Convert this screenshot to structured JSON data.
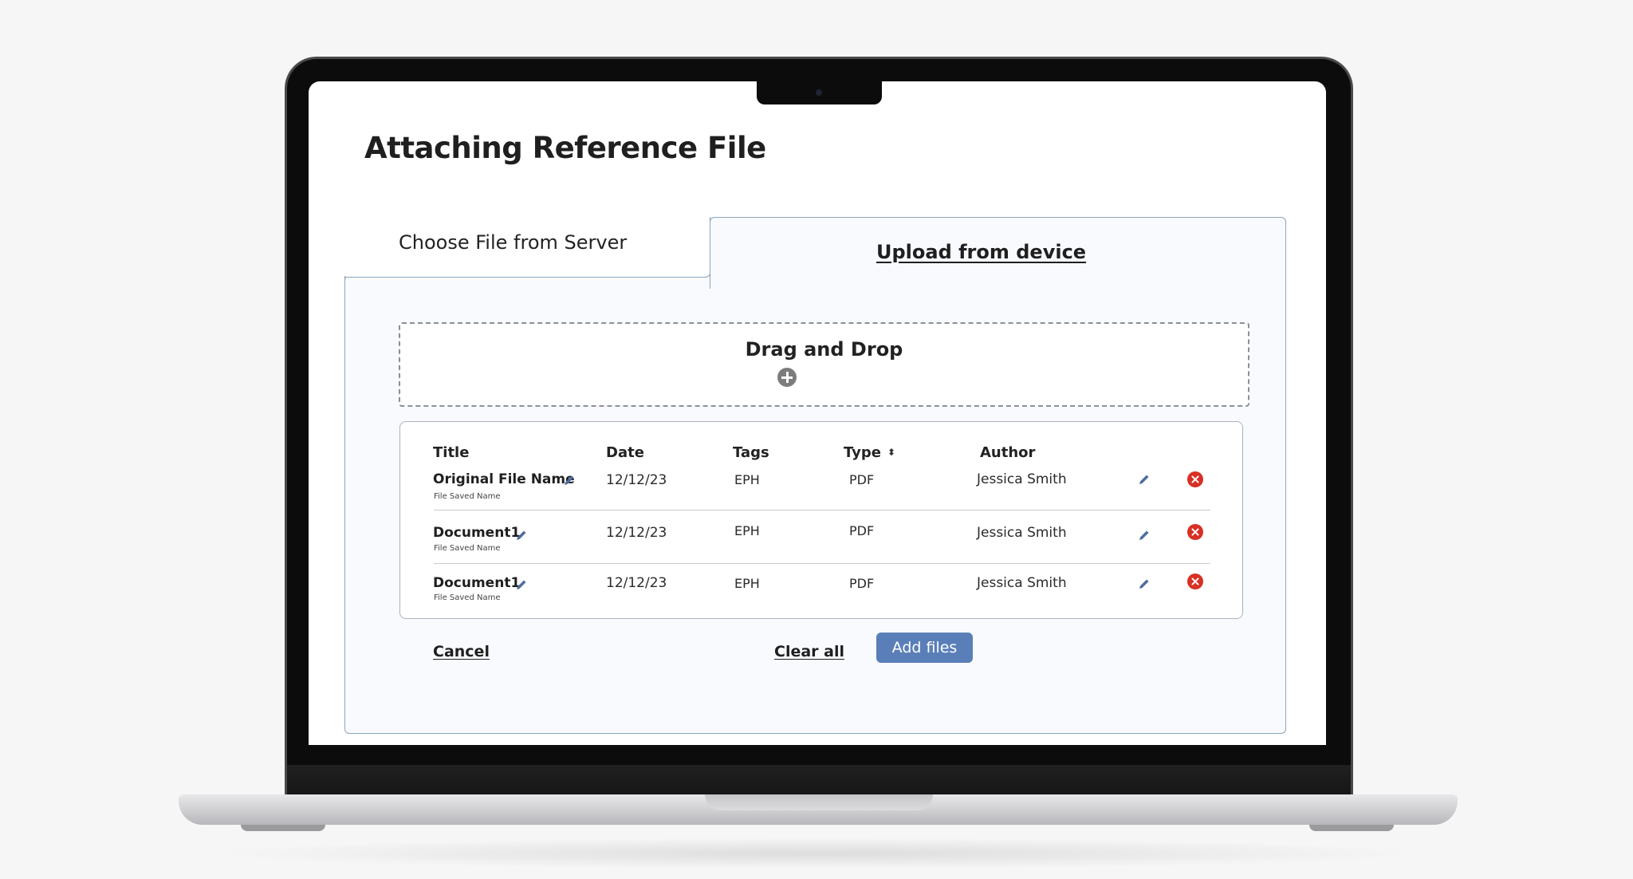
{
  "page": {
    "title": "Attaching Reference File"
  },
  "tabs": [
    {
      "label": "Choose File from Server",
      "active": false
    },
    {
      "label": "Upload from device",
      "active": true
    }
  ],
  "dropzone": {
    "label": "Drag and Drop",
    "icon": "plus-circle-icon"
  },
  "table": {
    "headers": {
      "title": "Title",
      "date": "Date",
      "tags": "Tags",
      "type": "Type",
      "author": "Author"
    },
    "rows": [
      {
        "title": "Original File Name",
        "subtitle": "File Saved Name",
        "date": "12/12/23",
        "tags": "EPH",
        "type": "PDF",
        "author": "Jessica Smith"
      },
      {
        "title": "Document1",
        "subtitle": "File Saved Name",
        "date": "12/12/23",
        "tags": "EPH",
        "type": "PDF",
        "author": "Jessica Smith"
      },
      {
        "title": "Document1",
        "subtitle": "File Saved Name",
        "date": "12/12/23",
        "tags": "EPH",
        "type": "PDF",
        "author": "Jessica Smith"
      }
    ]
  },
  "actions": {
    "cancel": "Cancel",
    "clear_all": "Clear all",
    "add_files": "Add files"
  },
  "colors": {
    "primary": "#5a7fb8",
    "danger": "#d93025",
    "panel_border": "#8ea3bd",
    "panel_bg": "#f8fafd"
  }
}
